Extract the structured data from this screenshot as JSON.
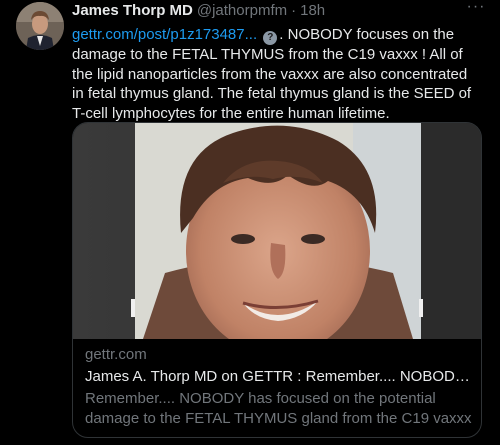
{
  "tweet": {
    "author_name": "James Thorp MD",
    "author_handle": "@jathorpmfm",
    "separator": "·",
    "time": "18h",
    "more_label": "···",
    "link_text": "gettr.com/post/p1z173487...",
    "question_glyph": "?",
    "text": ". NOBODY focuses on the damage to the FETAL THYMUS  from the C19 vaxxx !  All of the lipid nanoparticles from the vaxxx are also concentrated in fetal thymus gland. The fetal thymus gland is the SEED of T-cell lymphocytes for the entire human lifetime."
  },
  "card": {
    "domain": "gettr.com",
    "title": "James A. Thorp MD on GETTR : Remember.... NOBODY has ...",
    "description": "Remember.... NOBODY has focused on the potential damage to the FETAL THYMUS gland from the C19 vaxxx ! All of the ..."
  },
  "colors": {
    "background": "#000000",
    "text": "#e7e9ea",
    "secondary": "#71767b",
    "link": "#1d9bf0",
    "border": "#2f3336"
  }
}
